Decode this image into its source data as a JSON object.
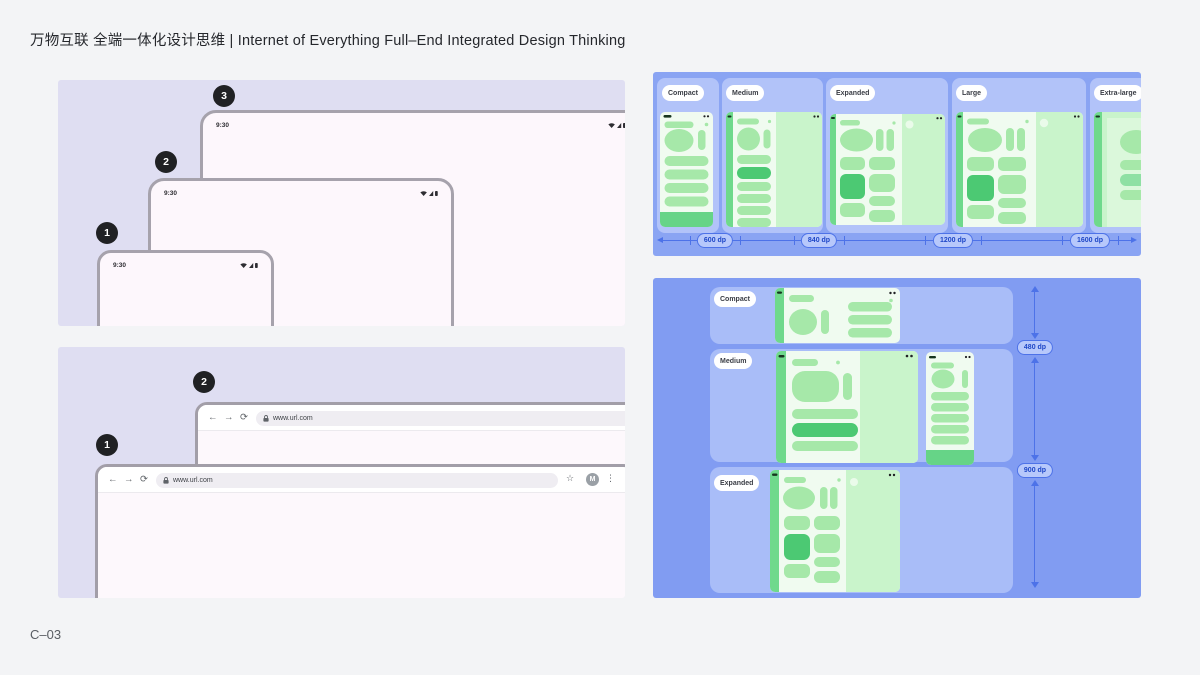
{
  "header": {
    "title": "万物互联 全端一体化设计思维 | Internet of Everything Full–End Integrated Design Thinking"
  },
  "footer": {
    "code": "C–03"
  },
  "colors": {
    "accent_blue": "#4d72e8",
    "panel_lavender": "#dfdef2",
    "panel_blue_top": "#8aa4f3",
    "panel_blue_bottom": "#819cf2",
    "green_rail": "#6fd98c",
    "green_light": "#a6e8a9",
    "green_mint": "#c9f4cb",
    "green_dark": "#4cc973",
    "badge_dark": "#202124"
  },
  "device_stack_panel": {
    "devices": [
      {
        "badge": "1",
        "clock": "9:30"
      },
      {
        "badge": "2",
        "clock": "9:30"
      },
      {
        "badge": "3",
        "clock": "9:30"
      }
    ]
  },
  "browser_stack_panel": {
    "windows": [
      {
        "badge": "1",
        "url": "www.url.com",
        "avatar": "M"
      },
      {
        "badge": "2",
        "url": "www.url.com"
      }
    ],
    "icons": {
      "back": "←",
      "forward": "→",
      "reload": "⟳",
      "bookmark": "☆",
      "menu": "⋮"
    }
  },
  "width_classes_panel": {
    "classes": [
      {
        "label": "Compact"
      },
      {
        "label": "Medium"
      },
      {
        "label": "Expanded"
      },
      {
        "label": "Large"
      },
      {
        "label": "Extra-large"
      }
    ],
    "breakpoints": [
      {
        "label": "600 dp"
      },
      {
        "label": "840 dp"
      },
      {
        "label": "1200 dp"
      },
      {
        "label": "1600 dp"
      }
    ]
  },
  "height_classes_panel": {
    "classes": [
      {
        "label": "Compact"
      },
      {
        "label": "Medium"
      },
      {
        "label": "Expanded"
      }
    ],
    "breakpoints": [
      {
        "label": "480 dp"
      },
      {
        "label": "900 dp"
      }
    ]
  }
}
